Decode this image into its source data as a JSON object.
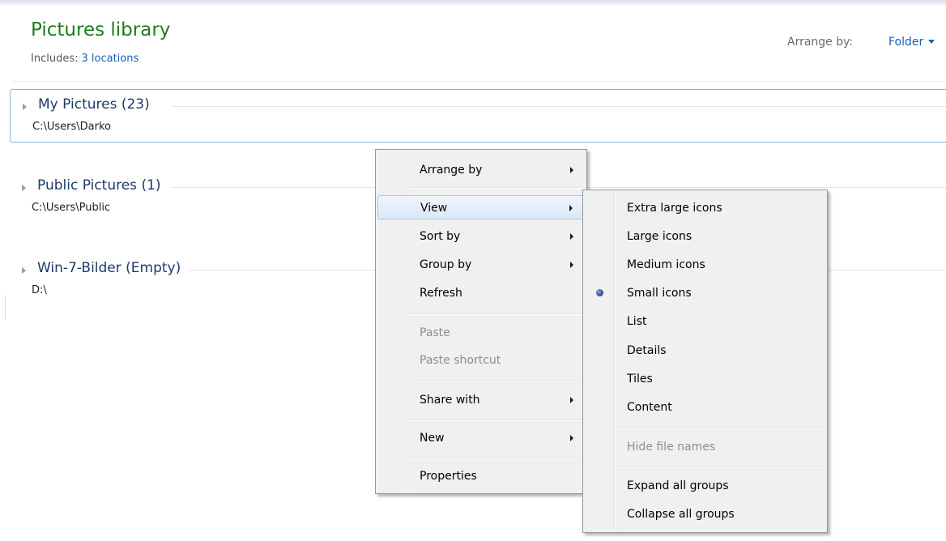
{
  "header": {
    "title": "Pictures library",
    "includes_label": "Includes:",
    "includes_link": "3 locations",
    "arrange_label": "Arrange by:",
    "arrange_value": "Folder"
  },
  "groups": [
    {
      "title": "My Pictures (23)",
      "path": "C:\\Users\\Darko"
    },
    {
      "title": "Public Pictures (1)",
      "path": "C:\\Users\\Public"
    },
    {
      "title": "Win-7-Bilder (Empty)",
      "path": "D:\\"
    }
  ],
  "context_menu": {
    "items": [
      {
        "label": "Arrange by"
      },
      {
        "label": "View"
      },
      {
        "label": "Sort by"
      },
      {
        "label": "Group by"
      },
      {
        "label": "Refresh"
      },
      {
        "label": "Paste"
      },
      {
        "label": "Paste shortcut"
      },
      {
        "label": "Share with"
      },
      {
        "label": "New"
      },
      {
        "label": "Properties"
      }
    ]
  },
  "view_submenu": {
    "items": [
      {
        "label": "Extra large icons"
      },
      {
        "label": "Large icons"
      },
      {
        "label": "Medium icons"
      },
      {
        "label": "Small icons",
        "selected": true
      },
      {
        "label": "List"
      },
      {
        "label": "Details"
      },
      {
        "label": "Tiles"
      },
      {
        "label": "Content"
      },
      {
        "label": "Hide file names"
      },
      {
        "label": "Expand all groups"
      },
      {
        "label": "Collapse all groups"
      }
    ]
  },
  "colors": {
    "title_green": "#1e7d1e",
    "link_blue": "#1a5fb4",
    "menu_background": "#f0f0f0",
    "highlight_border": "#a8c6ec"
  }
}
